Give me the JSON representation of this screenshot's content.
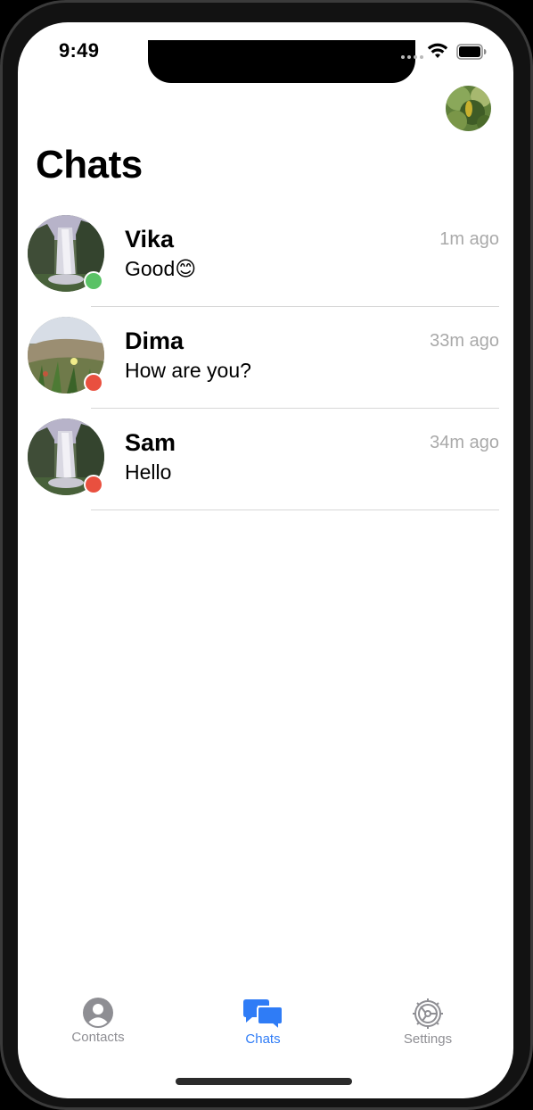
{
  "status_bar": {
    "time": "9:49"
  },
  "header": {
    "title": "Chats",
    "profile_avatar_icon": "landscape-photo-avatar"
  },
  "chats": [
    {
      "name": "Vika",
      "time": "1m ago",
      "message": "Good",
      "emoji": "😊",
      "online": true,
      "avatar": "waterfall-photo"
    },
    {
      "name": "Dima",
      "time": "33m ago",
      "message": "How are you?",
      "emoji": "",
      "online": false,
      "avatar": "hillside-flowers-photo"
    },
    {
      "name": "Sam",
      "time": "34m ago",
      "message": "Hello",
      "emoji": "",
      "online": false,
      "avatar": "waterfall-photo"
    }
  ],
  "tabbar": {
    "tabs": [
      {
        "label": "Contacts",
        "icon": "person-circle-icon",
        "active": false
      },
      {
        "label": "Chats",
        "icon": "chat-bubbles-icon",
        "active": true
      },
      {
        "label": "Settings",
        "icon": "gear-icon",
        "active": false
      }
    ]
  },
  "colors": {
    "accent": "#2f7cf6",
    "online": "#5ac266",
    "offline": "#e9503f",
    "inactive_tab": "#8e8e93",
    "secondary_text": "#a9a9a9"
  }
}
